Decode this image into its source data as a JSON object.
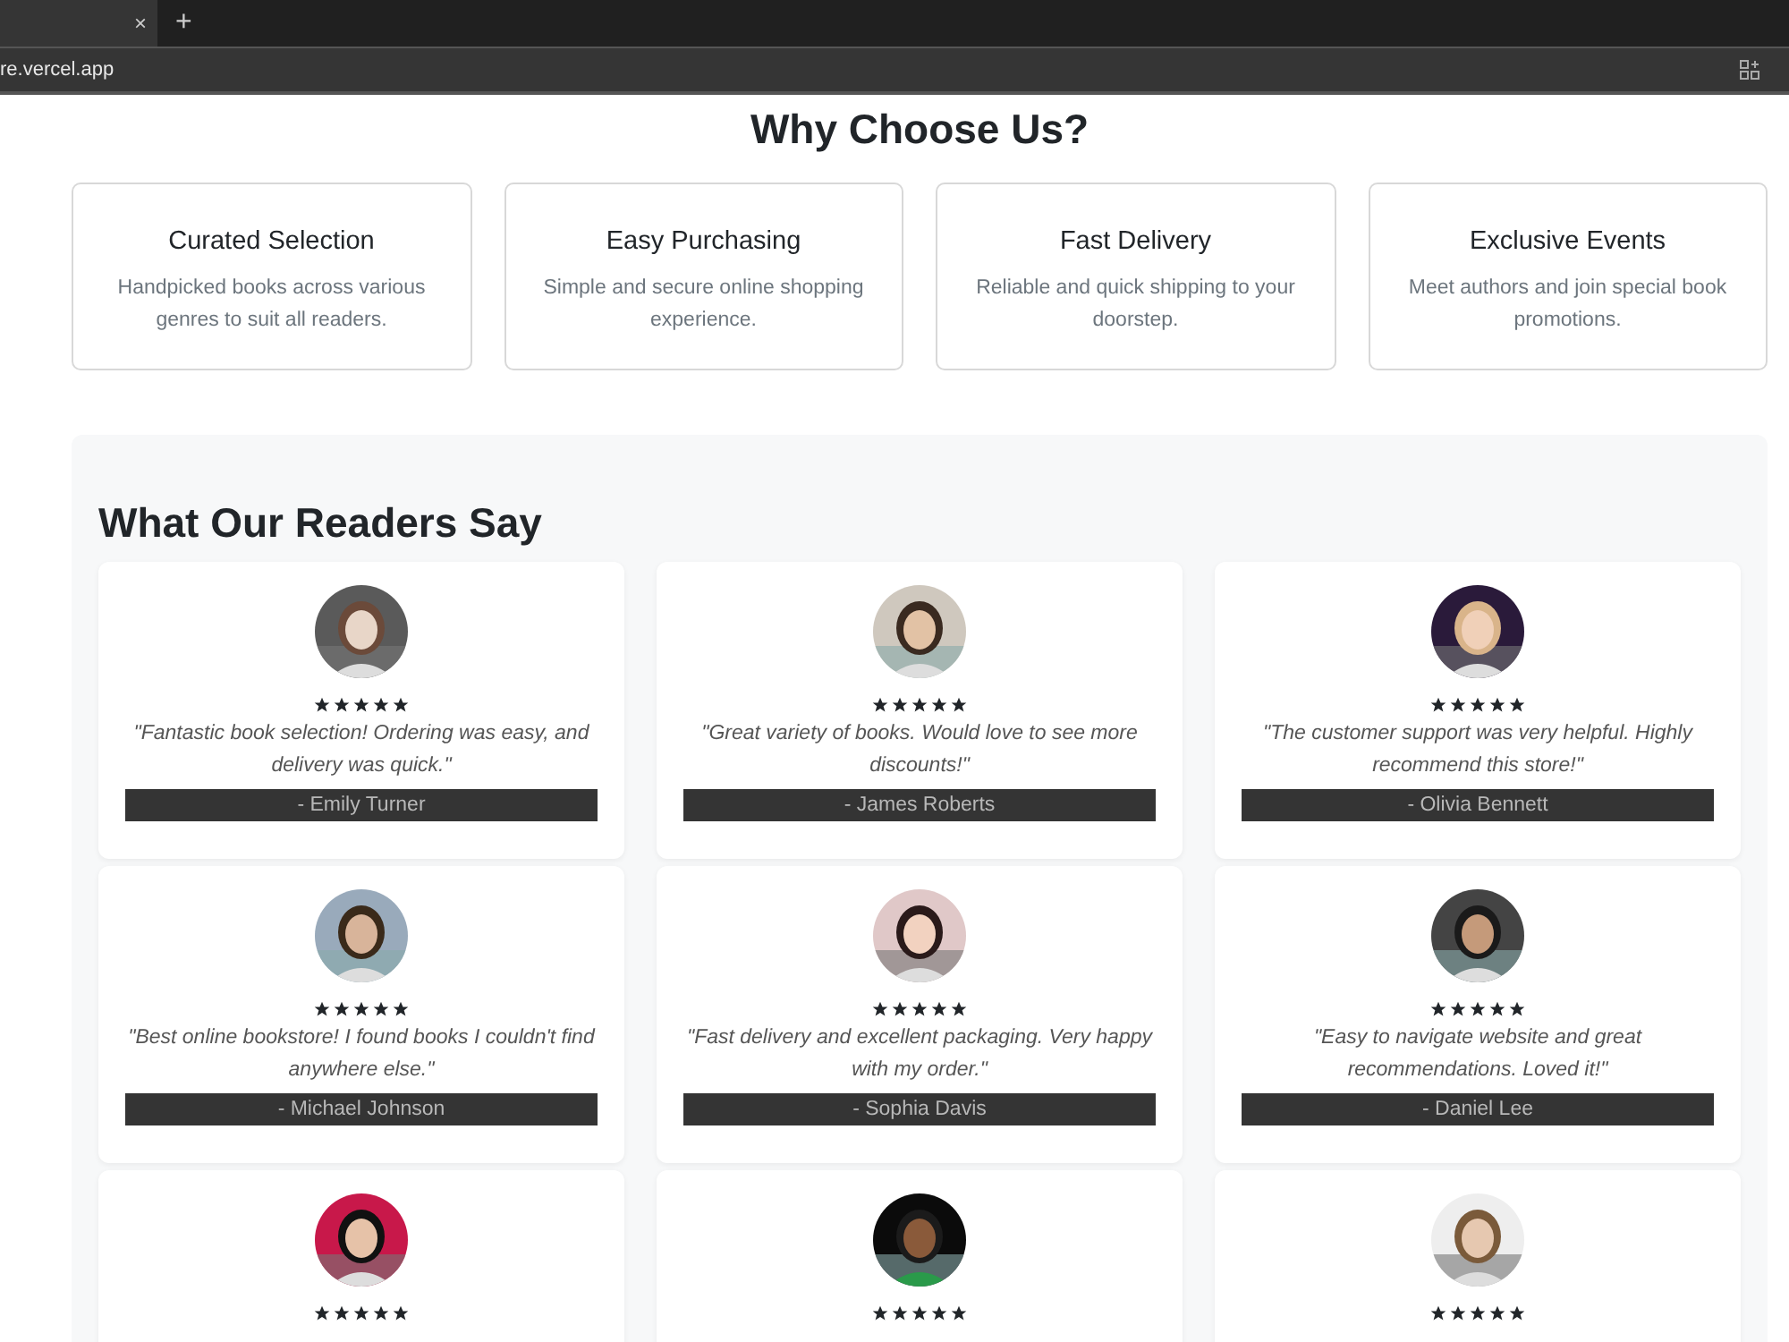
{
  "browser": {
    "tab_close": "×",
    "new_tab": "+",
    "url": "re.vercel.app"
  },
  "features": {
    "title": "Why Choose Us?",
    "items": [
      {
        "title": "Curated Selection",
        "text": "Handpicked books across various genres to suit all readers."
      },
      {
        "title": "Easy Purchasing",
        "text": "Simple and secure online shopping experience."
      },
      {
        "title": "Fast Delivery",
        "text": "Reliable and quick shipping to your doorstep."
      },
      {
        "title": "Exclusive Events",
        "text": "Meet authors and join special book promotions."
      }
    ]
  },
  "testimonials": {
    "title": "What Our Readers Say",
    "items": [
      {
        "stars": 5,
        "quote": "\"Fantastic book selection! Ordering was easy, and delivery was quick.\"",
        "name": "- Emily Turner"
      },
      {
        "stars": 5,
        "quote": "\"Great variety of books. Would love to see more discounts!\"",
        "name": "- James Roberts"
      },
      {
        "stars": 5,
        "quote": "\"The customer support was very helpful. Highly recommend this store!\"",
        "name": "- Olivia Bennett"
      },
      {
        "stars": 5,
        "quote": "\"Best online bookstore! I found books I couldn't find anywhere else.\"",
        "name": "- Michael Johnson"
      },
      {
        "stars": 5,
        "quote": "\"Fast delivery and excellent packaging. Very happy with my order.\"",
        "name": "- Sophia Davis"
      },
      {
        "stars": 5,
        "quote": "\"Easy to navigate website and great recommendations. Loved it!\"",
        "name": "- Daniel Lee"
      },
      {
        "stars": 5
      },
      {
        "stars": 5
      },
      {
        "stars": 5
      }
    ]
  }
}
